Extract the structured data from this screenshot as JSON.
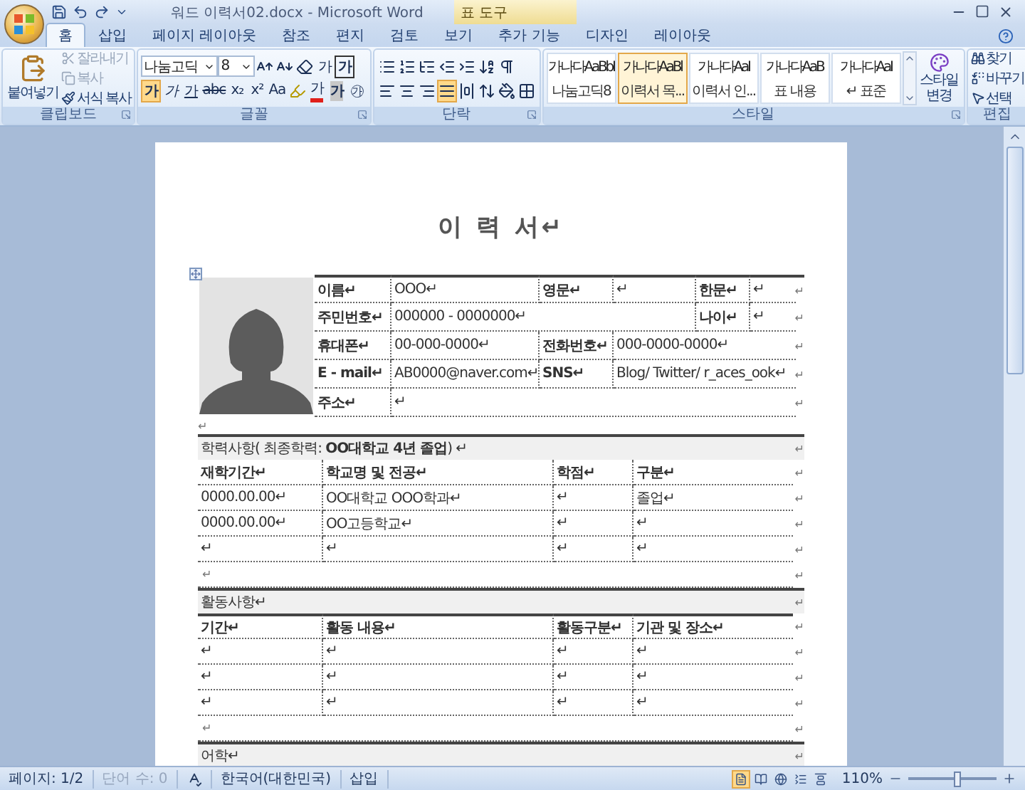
{
  "window": {
    "title": "워드 이력서02.docx - Microsoft Word",
    "context_tab": "표 도구"
  },
  "tabs": [
    {
      "label": "홈",
      "selected": true
    },
    {
      "label": "삽입",
      "selected": false
    },
    {
      "label": "페이지 레이아웃",
      "selected": false
    },
    {
      "label": "참조",
      "selected": false
    },
    {
      "label": "편지",
      "selected": false
    },
    {
      "label": "검토",
      "selected": false
    },
    {
      "label": "보기",
      "selected": false
    },
    {
      "label": "추가 기능",
      "selected": false
    },
    {
      "label": "디자인",
      "selected": false
    },
    {
      "label": "레이아웃",
      "selected": false
    }
  ],
  "ribbon": {
    "clipboard": {
      "label": "클립보드",
      "paste": "붙여넣기",
      "actions": [
        {
          "kind": "cut",
          "label": "잘라내기",
          "disabled": true
        },
        {
          "kind": "copy",
          "label": "복사",
          "disabled": true
        },
        {
          "kind": "format",
          "label": "서식 복사",
          "disabled": false
        }
      ]
    },
    "font": {
      "label": "글꼴",
      "name": "나눔고딕",
      "size": "8",
      "tools": [
        {
          "kind": "grow"
        },
        {
          "kind": "shrink"
        },
        {
          "kind": "clear"
        },
        {
          "kind": "text",
          "label": "가"
        },
        {
          "kind": "boxed",
          "label": "가"
        }
      ],
      "styles": [
        {
          "kind": "bold",
          "label": "가",
          "selected": true
        },
        {
          "kind": "italic",
          "label": "가",
          "selected": false
        },
        {
          "kind": "underline",
          "label": "가",
          "selected": false
        },
        {
          "kind": "strike",
          "label": "abc",
          "selected": false
        },
        {
          "kind": "sub",
          "label": "x₂",
          "selected": false
        },
        {
          "kind": "sup",
          "label": "x²",
          "selected": false
        },
        {
          "kind": "case",
          "label": "Aa",
          "selected": false
        }
      ],
      "colors": [
        {
          "kind": "highlight"
        },
        {
          "kind": "color",
          "label": "가"
        },
        {
          "kind": "shade",
          "label": "가"
        },
        {
          "kind": "enclose",
          "label": "㉮"
        }
      ]
    },
    "paragraph": {
      "label": "단락",
      "tools": [
        {
          "kind": "bullets"
        },
        {
          "kind": "numbers"
        },
        {
          "kind": "multilevel"
        },
        {
          "kind": "outdent"
        },
        {
          "kind": "indent"
        },
        {
          "kind": "sort"
        },
        {
          "kind": "marks"
        }
      ],
      "alignment": [
        {
          "kind": "left",
          "selected": false
        },
        {
          "kind": "center",
          "selected": false
        },
        {
          "kind": "right",
          "selected": false
        },
        {
          "kind": "justify",
          "selected": true
        },
        {
          "kind": "distribute",
          "selected": false
        },
        {
          "kind": "spacing",
          "selected": false
        },
        {
          "kind": "shading",
          "selected": false
        },
        {
          "kind": "borders",
          "selected": false
        }
      ]
    },
    "styles": {
      "label": "스타일",
      "change": "스타일 변경",
      "items": [
        {
          "preview": "가나다AaBbI",
          "name": "나눔고딕8",
          "selected": false
        },
        {
          "preview": "가나다AaBl",
          "name": "이력서 목...",
          "selected": true
        },
        {
          "preview": "가나다AaI",
          "name": "이력서 인...",
          "selected": false
        },
        {
          "preview": "가나다AaB",
          "name": "표 내용",
          "selected": false
        },
        {
          "preview": "가나다AaI",
          "name": "↵ 표준",
          "selected": false
        }
      ]
    },
    "editing": {
      "label": "편집",
      "actions": [
        {
          "kind": "find",
          "label": "찾기"
        },
        {
          "kind": "replace",
          "label": "바꾸기"
        },
        {
          "kind": "select",
          "label": "선택"
        }
      ]
    }
  },
  "document": {
    "title": "이 력 서↵",
    "profile": [
      {
        "cells": [
          {
            "kind": "label",
            "text": "이름↵"
          },
          {
            "kind": "value",
            "text": "OOO↵"
          },
          {
            "kind": "label",
            "text": "영문↵"
          },
          {
            "kind": "value",
            "text": "↵"
          },
          {
            "kind": "label",
            "text": "한문↵"
          },
          {
            "kind": "value",
            "text": "↵"
          }
        ],
        "end": "↵"
      },
      {
        "cells": [
          {
            "kind": "label",
            "text": "주민번호↵"
          },
          {
            "kind": "value",
            "text": "000000 - 0000000↵"
          },
          {
            "kind": "label",
            "text": "나이↵"
          },
          {
            "kind": "value",
            "text": "↵"
          }
        ],
        "end": "↵"
      },
      {
        "cells": [
          {
            "kind": "label",
            "text": "휴대폰↵"
          },
          {
            "kind": "value",
            "text": "00-000-0000↵"
          },
          {
            "kind": "label",
            "text": "전화번호↵"
          },
          {
            "kind": "value",
            "text": "000-0000-0000↵"
          }
        ],
        "end": "↵"
      },
      {
        "cells": [
          {
            "kind": "label",
            "text": "E - mail↵"
          },
          {
            "kind": "value",
            "text": "AB0000@naver.com↵"
          },
          {
            "kind": "label",
            "text": "SNS↵"
          },
          {
            "kind": "value",
            "text": "Blog/ Twitter/ r_aces_ook↵"
          }
        ],
        "end": "↵"
      },
      {
        "cells": [
          {
            "kind": "label",
            "text": "주소↵"
          },
          {
            "kind": "value",
            "text": "↵"
          }
        ],
        "end": "↵"
      }
    ],
    "gap": "↵",
    "sections": [
      {
        "heading": "학력사항( 최종학력: **OO대학교 4년 졸업**) ↵",
        "columns": [
          "재학기간↵",
          "학교명 및 전공↵",
          "학점↵",
          "구분↵"
        ],
        "rows": [
          [
            "0000.00.00↵",
            "OO대학교 OOO학과↵",
            "↵",
            "졸업↵"
          ],
          [
            "0000.00.00↵",
            "OO고등학교↵",
            "↵",
            "↵"
          ],
          [
            "↵",
            "↵",
            "↵",
            "↵"
          ]
        ],
        "blank": "↵"
      },
      {
        "heading": "활동사항↵",
        "columns": [
          "기간↵",
          "활동 내용↵",
          "활동구분↵",
          "기관 및 장소↵"
        ],
        "rows": [
          [
            "↵",
            "↵",
            "↵",
            "↵"
          ],
          [
            "↵",
            "↵",
            "↵",
            "↵"
          ],
          [
            "↵",
            "↵",
            "↵",
            "↵"
          ]
        ],
        "blank": "↵"
      },
      {
        "heading": "어학↵"
      }
    ],
    "end": "↵"
  },
  "status_bar": {
    "items": [
      {
        "kind": "text",
        "label": "페이지: 1/2",
        "disabled": false
      },
      {
        "kind": "text",
        "label": "단어 수: 0",
        "disabled": true
      },
      {
        "kind": "spell"
      },
      {
        "kind": "text",
        "label": "한국어(대한민국)",
        "disabled": false
      },
      {
        "kind": "text",
        "label": "삽입",
        "disabled": false
      }
    ],
    "views": [
      {
        "kind": "print",
        "selected": true
      },
      {
        "kind": "reading",
        "selected": false
      },
      {
        "kind": "web",
        "selected": false
      },
      {
        "kind": "outline",
        "selected": false
      },
      {
        "kind": "draft",
        "selected": false
      }
    ],
    "zoom": "110%",
    "zoom_level": {
      "level": 0.55
    }
  }
}
